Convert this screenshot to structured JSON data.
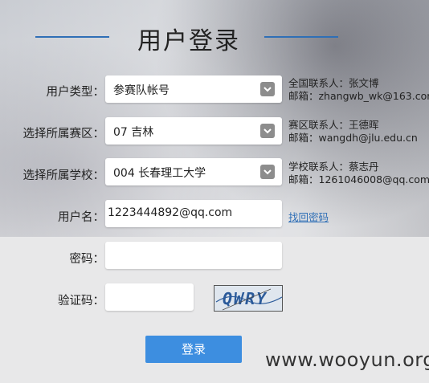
{
  "page": {
    "title": "用户登录"
  },
  "form": {
    "user_type": {
      "label": "用户类型：",
      "value": "参赛队帐号"
    },
    "region": {
      "label": "选择所属赛区：",
      "value": "07 吉林"
    },
    "school": {
      "label": "选择所属学校：",
      "value": "004 长春理工大学"
    },
    "username": {
      "label": "用户名：",
      "value": "1223444892@qq.com"
    },
    "password": {
      "label": "密码：",
      "value": ""
    },
    "captcha": {
      "label": "验证码：",
      "value": "",
      "image_text": "QWRY"
    },
    "login_label": "登录"
  },
  "contacts": {
    "national": {
      "line1": "全国联系人：张文博",
      "line2": "邮箱：zhangwb_wk@163.com"
    },
    "region": {
      "line1": "赛区联系人：王德晖",
      "line2": "邮箱：wangdh@jlu.edu.cn"
    },
    "school": {
      "line1": "学校联系人：蔡志丹",
      "line2": "邮箱：1261046008@qq.com"
    }
  },
  "recover_password": "找回密码",
  "watermark": "www.wooyun.org",
  "colors": {
    "accent": "#3d8ee0",
    "link": "#2f6fb6"
  }
}
